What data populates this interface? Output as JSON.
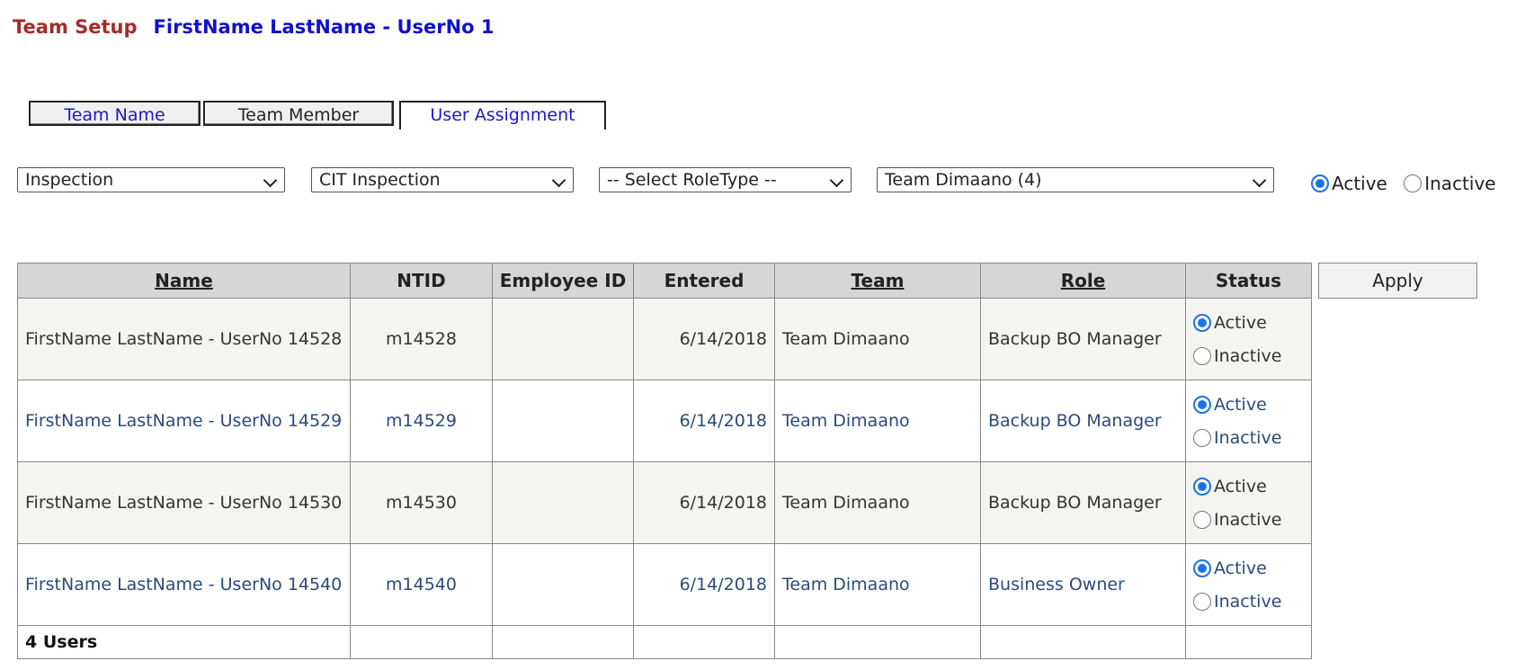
{
  "header": {
    "section": "Team Setup",
    "user": "FirstName LastName - UserNo 1"
  },
  "tabs": [
    {
      "label": "Team Name"
    },
    {
      "label": "Team Member"
    },
    {
      "label": "User Assignment"
    }
  ],
  "filters": {
    "category": "Inspection",
    "subcategory": "CIT Inspection",
    "roletype": "-- Select RoleType --",
    "team": "Team Dimaano (4)",
    "status_active": "Active",
    "status_inactive": "Inactive",
    "status_selected": "Active"
  },
  "table": {
    "headers": [
      "Name",
      "NTID",
      "Employee ID",
      "Entered",
      "Team",
      "Role",
      "Status"
    ],
    "rows": [
      {
        "name": "FirstName LastName - UserNo 14528",
        "ntid": "m14528",
        "employee_id": "",
        "entered": "6/14/2018",
        "team": "Team Dimaano",
        "role": "Backup BO Manager",
        "status": "Active"
      },
      {
        "name": "FirstName LastName - UserNo 14529",
        "ntid": "m14529",
        "employee_id": "",
        "entered": "6/14/2018",
        "team": "Team Dimaano",
        "role": "Backup BO Manager",
        "status": "Active"
      },
      {
        "name": "FirstName LastName - UserNo 14530",
        "ntid": "m14530",
        "employee_id": "",
        "entered": "6/14/2018",
        "team": "Team Dimaano",
        "role": "Backup BO Manager",
        "status": "Active"
      },
      {
        "name": "FirstName LastName - UserNo 14540",
        "ntid": "m14540",
        "employee_id": "",
        "entered": "6/14/2018",
        "team": "Team Dimaano",
        "role": "Business Owner",
        "status": "Active"
      }
    ],
    "status_active_label": "Active",
    "status_inactive_label": "Inactive",
    "footer": "4 Users"
  },
  "apply_label": "Apply",
  "colors": {
    "accent": "#a52a2a",
    "link": "#1a1acc",
    "radio": "#1a73e8"
  }
}
